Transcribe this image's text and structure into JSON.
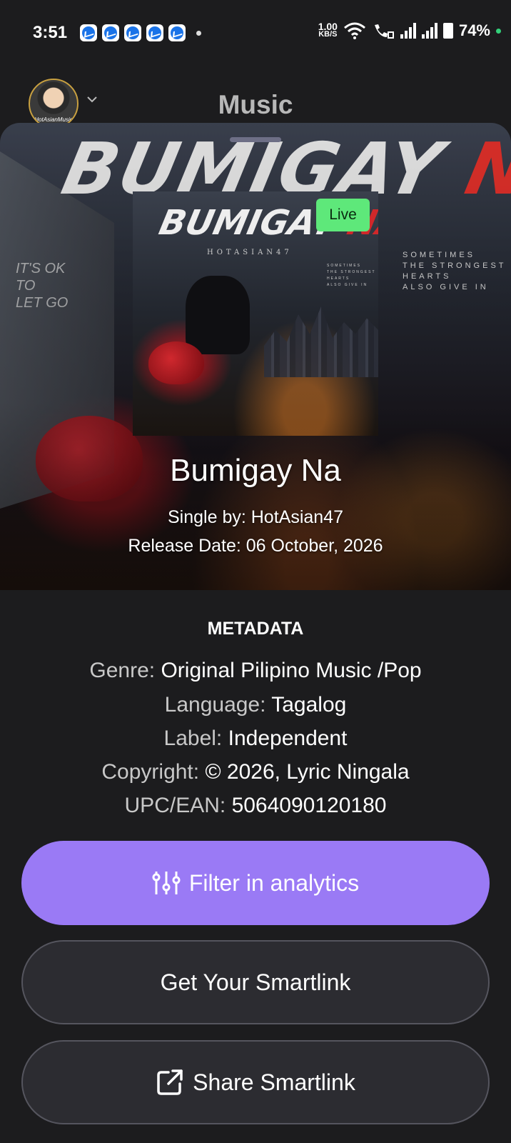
{
  "status_bar": {
    "time": "3:51",
    "notification_count": 5,
    "net_speed_value": "1.00",
    "net_speed_unit": "KB/S",
    "battery": "74%"
  },
  "header": {
    "title": "Music",
    "avatar_caption": "HotAsianMusic"
  },
  "hero": {
    "artwork_title": "BUMIGAY",
    "artwork_title_accent": "NA",
    "artwork_artist": "HOTASIAN47",
    "artwork_tagline": [
      "SOMETIMES",
      "THE STRONGEST",
      "HEARTS",
      "ALSO GIVE IN"
    ],
    "wall_text": [
      "IT'S OK",
      "TO",
      "LET GO"
    ],
    "status_badge": "Live",
    "song_title": "Bumigay Na",
    "single_by": "Single by: HotAsian47",
    "release_date": "Release Date: 06 October, 2026"
  },
  "metadata": {
    "heading": "METADATA",
    "genre_key": "Genre:",
    "genre_value": "Original Pilipino Music /Pop",
    "language_key": "Language:",
    "language_value": "Tagalog",
    "label_key": "Label:",
    "label_value": "Independent",
    "copyright_key": "Copyright:",
    "copyright_value": "© 2026, Lyric Ningala",
    "upc_key": "UPC/EAN:",
    "upc_value": "5064090120180"
  },
  "buttons": {
    "filter_label": "Filter in analytics",
    "smartlink_label": "Get Your Smartlink",
    "share_label": "Share Smartlink"
  },
  "colors": {
    "background": "#1c1c1e",
    "primary_button": "#9a7af5",
    "live_badge": "#5ee87a",
    "accent_red": "#e0302a"
  },
  "icons": [
    "messenger-icon",
    "wifi-icon",
    "wifi-call-icon",
    "signal-icon",
    "battery-icon",
    "chevron-down-icon",
    "sliders-icon",
    "external-link-icon"
  ]
}
